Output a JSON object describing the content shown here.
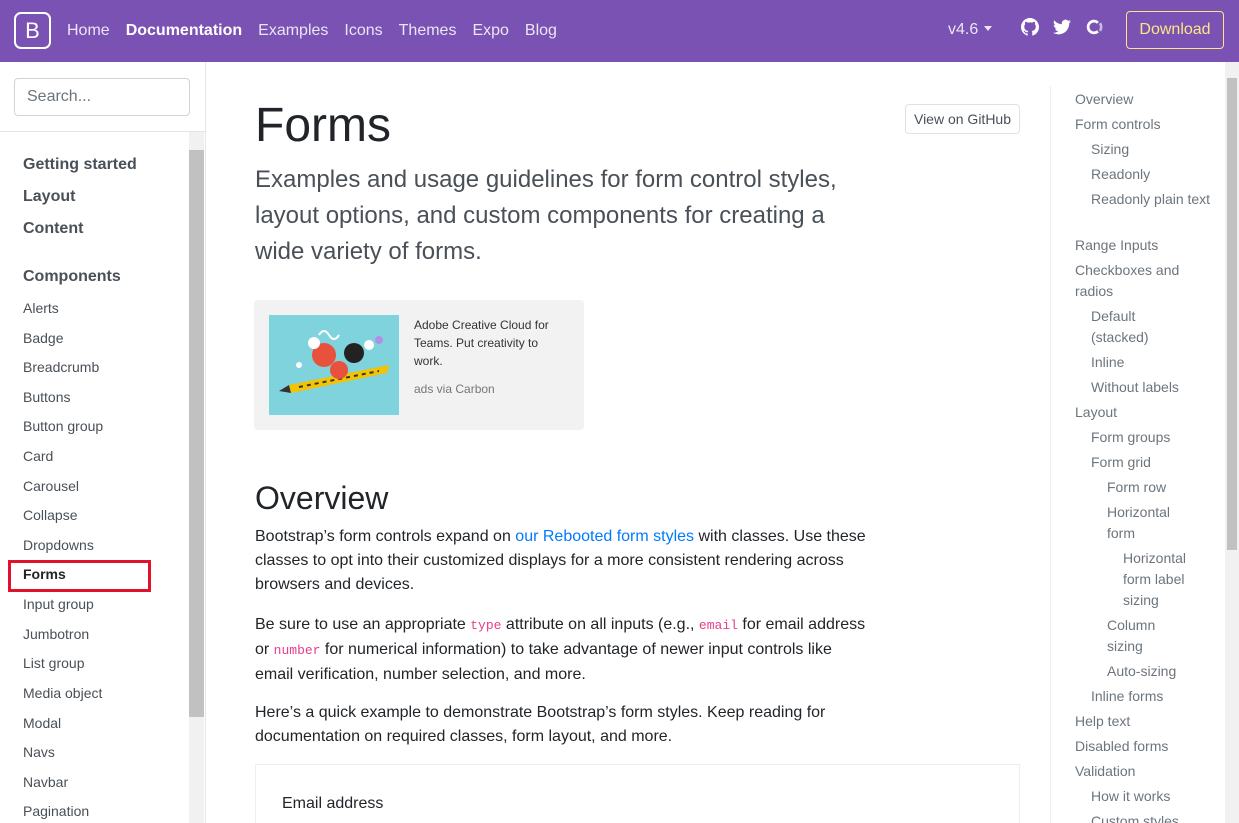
{
  "navbar": {
    "brand": "B",
    "links": [
      "Home",
      "Documentation",
      "Examples",
      "Icons",
      "Themes",
      "Expo",
      "Blog"
    ],
    "active": "Documentation",
    "version": "v4.6",
    "download": "Download",
    "icons": [
      "github-icon",
      "twitter-icon",
      "opencollective-icon"
    ],
    "colors": {
      "background": "#7952b3",
      "download": "#ffe484"
    }
  },
  "sidebar": {
    "search_placeholder": "Search...",
    "sections": [
      "Getting started",
      "Layout",
      "Content",
      "Components"
    ],
    "items": [
      "Alerts",
      "Badge",
      "Breadcrumb",
      "Buttons",
      "Button group",
      "Card",
      "Carousel",
      "Collapse",
      "Dropdowns",
      "Forms",
      "Input group",
      "Jumbotron",
      "List group",
      "Media object",
      "Modal",
      "Navs",
      "Navbar",
      "Pagination"
    ],
    "current": "Forms",
    "highlight_color": "#e0112b"
  },
  "main": {
    "title": "Forms",
    "github_button": "View on GitHub",
    "lead": "Examples and usage guidelines for form control styles, layout options, and custom components for creating a wide variety of forms.",
    "ad": {
      "text": "Adobe Creative Cloud for Teams. Put creativity to work.",
      "via": "ads via Carbon"
    },
    "overview_heading": "Overview",
    "p1": {
      "before": "Bootstrap’s form controls expand on ",
      "link": "our Rebooted form styles",
      "after": " with classes. Use these classes to opt into their customized displays for a more consistent rendering across browsers and devices."
    },
    "p2": {
      "t1": "Be sure to use an appropriate ",
      "c1": "type",
      "t2": " attribute on all inputs (e.g., ",
      "c2": "email",
      "t3": " for email address or ",
      "c3": "number",
      "t4": " for numerical information) to take advantage of newer input controls like email verification, number selection, and more."
    },
    "p3": "Here’s a quick example to demonstrate Bootstrap’s form styles. Keep reading for documentation on required classes, form layout, and more.",
    "example_label": "Email address"
  },
  "toc": {
    "items": [
      {
        "label": "Overview",
        "level": 0
      },
      {
        "label": "Form controls",
        "level": 0
      },
      {
        "label": "Sizing",
        "level": 1
      },
      {
        "label": "Readonly",
        "level": 1
      },
      {
        "label": "Readonly plain text",
        "level": 1
      },
      {
        "label": "Range Inputs",
        "level": 0
      },
      {
        "label": "Checkboxes and radios",
        "level": 0
      },
      {
        "label": "Default (stacked)",
        "level": 1
      },
      {
        "label": "Inline",
        "level": 1
      },
      {
        "label": "Without labels",
        "level": 1
      },
      {
        "label": "Layout",
        "level": 0
      },
      {
        "label": "Form groups",
        "level": 1
      },
      {
        "label": "Form grid",
        "level": 1
      },
      {
        "label": "Form row",
        "level": 2
      },
      {
        "label": "Horizontal form",
        "level": 2
      },
      {
        "label": "Horizontal form label sizing",
        "level": 3
      },
      {
        "label": "Column sizing",
        "level": 2
      },
      {
        "label": "Auto-sizing",
        "level": 2
      },
      {
        "label": "Inline forms",
        "level": 1
      },
      {
        "label": "Help text",
        "level": 0
      },
      {
        "label": "Disabled forms",
        "level": 0
      },
      {
        "label": "Validation",
        "level": 0
      },
      {
        "label": "How it works",
        "level": 1
      },
      {
        "label": "Custom styles",
        "level": 1
      }
    ]
  }
}
